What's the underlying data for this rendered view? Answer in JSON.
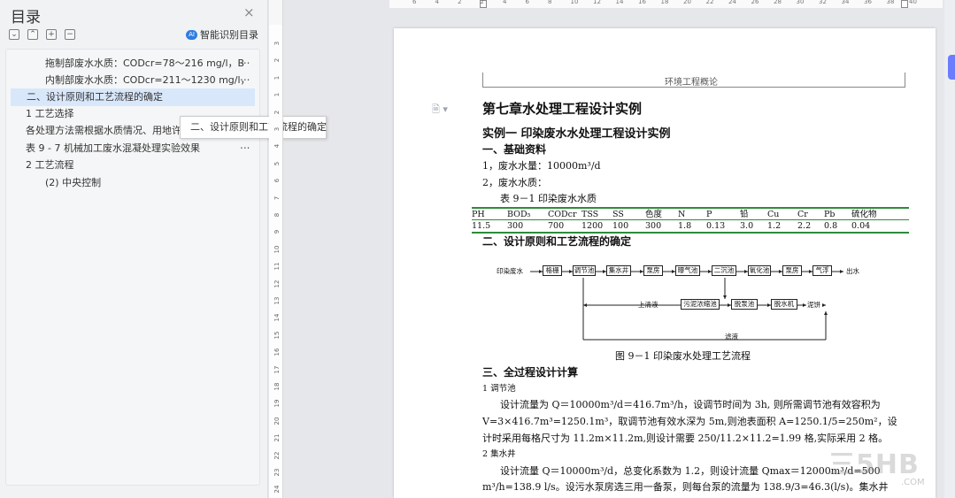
{
  "toc": {
    "title": "目录",
    "close_glyph": "×",
    "smart_label": "智能识别目录",
    "tooltip": "二、设计原则和工艺流程的确定",
    "items": [
      {
        "label": "拖制部废水水质：CODcr=78～216 mg/l，B",
        "more": "..."
      },
      {
        "label": "内制部废水水质：CODcr=211～1230 mg/l，B",
        "more": "..."
      },
      {
        "label": "二、设计原则和工艺流程的确定",
        "active": true
      },
      {
        "label": "1   工艺选择"
      },
      {
        "label": "各处理方法需根据水质情况、用地许可"
      },
      {
        "label": "表 9 - 7   机械加工废水混凝处理实验效果",
        "more": "..."
      },
      {
        "label": "2   工艺流程"
      },
      {
        "label": "(2)  中央控制"
      }
    ]
  },
  "rulers": {
    "vertical": [
      "3",
      "2",
      "1",
      "1",
      "2",
      "3",
      "4",
      "5",
      "6",
      "7",
      "8",
      "9",
      "10",
      "11",
      "12",
      "13",
      "14",
      "15",
      "16",
      "17",
      "18",
      "19",
      "20",
      "21",
      "22",
      "23",
      "24"
    ],
    "horizontal": [
      "6",
      "4",
      "2",
      "2",
      "4",
      "6",
      "8",
      "10",
      "12",
      "14",
      "16",
      "18",
      "20",
      "22",
      "24",
      "26",
      "28",
      "30",
      "32",
      "34",
      "36",
      "38",
      "40"
    ]
  },
  "document": {
    "running_header": "环境工程概论",
    "chapter_title": "第七章水处理工程设计实例",
    "example_title": "实例一     印染废水水处理工程设计实例",
    "sec1": "一、基础资料",
    "flow_volume": "1，废水水量：10000m³/d",
    "quality_label": "2，废水水质：",
    "table_caption": "表 9－1    印染废水水质",
    "table_headers": [
      "PH",
      "BOD₅",
      "CODcr",
      "TSS",
      "SS",
      "色度",
      "N",
      "P",
      "铅",
      "Cu",
      "Cr",
      "Pb",
      "硫化物"
    ],
    "table_values": [
      "11.5",
      "300",
      "700",
      "1200",
      "100",
      "300",
      "1.8",
      "0.13",
      "3.0",
      "1.2",
      "2.2",
      "0.8",
      "0.04"
    ],
    "sec2": "二、设计原则和工艺流程的确定",
    "flow": {
      "input": "印染废水",
      "row1": [
        "格栅",
        "调节池",
        "集水井",
        "泵房",
        "曝气池",
        "二沉池",
        "氧化池",
        "泵房",
        "气浮"
      ],
      "output": "出水",
      "row2": [
        "污泥浓缩池",
        "脱泵池",
        "脱水机"
      ],
      "supernatant": "上清液",
      "cake": "泥饼",
      "filtrate": "滤液"
    },
    "figure_caption": "图 9－1    印染废水处理工艺流程",
    "sec3": "三、全过程设计计算",
    "sub1": "1     调节池",
    "para1_l1": "设计流量为 Q＝10000m³/d＝416.7m³/h，设调节时间为 3h, 则所需调节池有效容积为",
    "para1_l2": "V=3×416.7m³=1250.1m³，取调节池有效水深为 5m,则池表面积 A=1250.1/5=250m²，设",
    "para1_l3": "计时采用每格尺寸为 11.2m×11.2m,则设计需要 250/11.2×11.2=1.99 格,实际采用 2 格。",
    "sub2": "2     集水井",
    "para2_l1": "设计流量 Q＝10000m³/d，总变化系数为 1.2，则设计流量 Qmax＝12000m³/d=500",
    "para2_l2": "m³/h=138.9 l/s。设污水泵房选三用一备泵，则每台泵的流量为 138.9/3=46.3(l/s)。集水井"
  },
  "watermark": {
    "main": "三5HB",
    "sub": ".COM"
  },
  "colors": {
    "table_rule": "#2e8b3a",
    "toc_active": "#d9e7fb",
    "accent": "#2f7de1"
  }
}
